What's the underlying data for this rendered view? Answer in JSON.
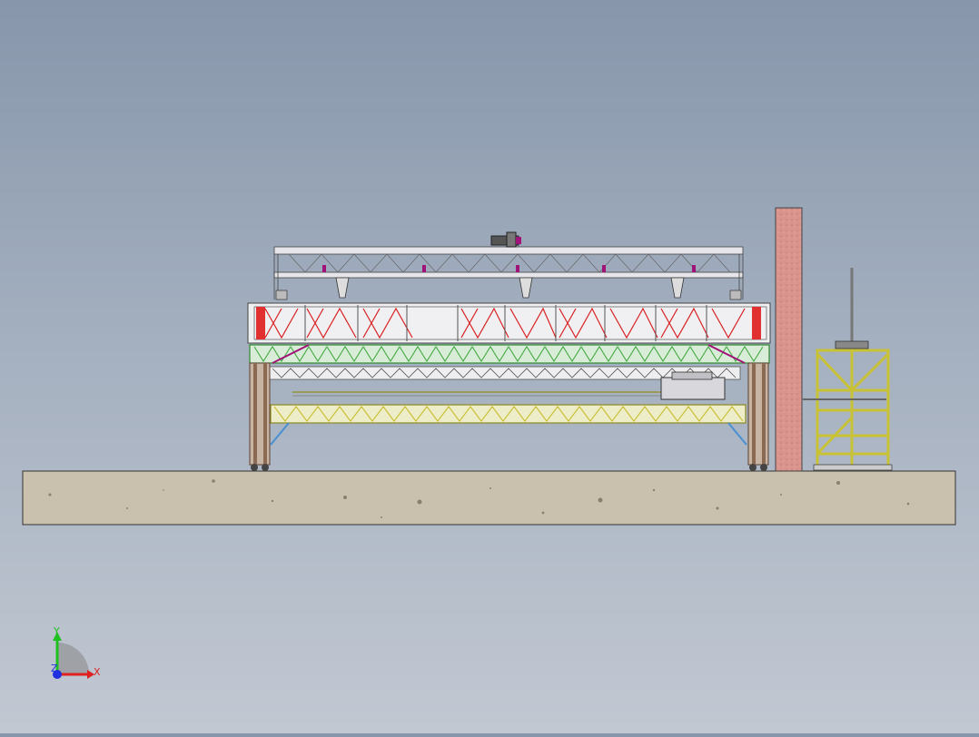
{
  "viewport": {
    "background_top": "#8796ab",
    "background_bottom": "#c2c8d2"
  },
  "colors": {
    "ground": "#c9c1ad",
    "wall": "#d9958d",
    "frame_gray": "#e6e6ea",
    "truss_red": "#d92020",
    "truss_green": "#3aa63a",
    "truss_yellow": "#c9c234",
    "column_brown": "#8a6a52",
    "brace_blue": "#4a8fd0",
    "accent_purple": "#a0147a"
  },
  "triad": {
    "x_label": "X",
    "y_label": "Y",
    "z_label": "Z",
    "x_color": "#e02020",
    "y_color": "#20c020",
    "z_color": "#2030e0"
  }
}
